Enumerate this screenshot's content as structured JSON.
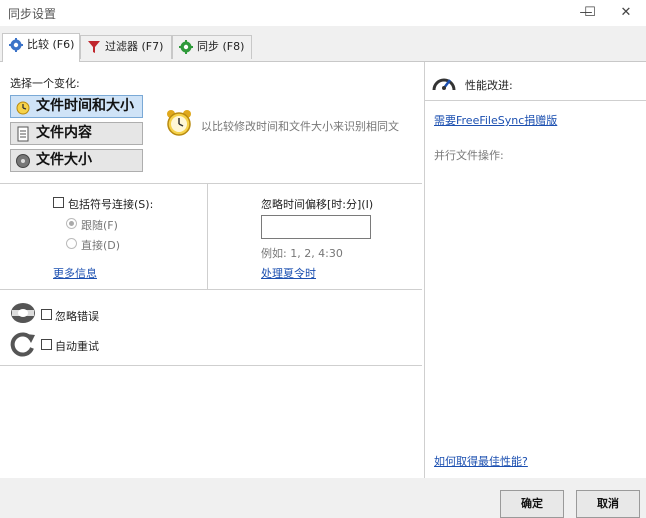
{
  "window": {
    "title": "同步设置",
    "minimize_glyph": "—",
    "maximize_glyph": "☐",
    "close_glyph": "✕"
  },
  "tabs": [
    {
      "label": "比较 (F6)",
      "icon": "gear-blue-icon",
      "active": true
    },
    {
      "label": "过滤器 (F7)",
      "icon": "filter-icon",
      "active": false
    },
    {
      "label": "同步 (F8)",
      "icon": "gear-green-icon",
      "active": false
    }
  ],
  "compare": {
    "variant_heading": "选择一个变化:",
    "variants": [
      {
        "label": "文件时间和大小",
        "icon": "clock-icon",
        "selected": true
      },
      {
        "label": "文件内容",
        "icon": "document-icon",
        "selected": false
      },
      {
        "label": "文件大小",
        "icon": "disk-icon",
        "selected": false
      }
    ],
    "variant_description": "以比较修改时间和文件大小来识别相同文",
    "symlink": {
      "checkbox_label": "包括符号连接(S):",
      "checked": false,
      "options": [
        {
          "label": "跟随(F)",
          "selected": true
        },
        {
          "label": "直接(D)",
          "selected": false
        }
      ],
      "more_info_link": "更多信息"
    },
    "time_shift": {
      "label": "忽略时间偏移[时:分](I)",
      "value": "",
      "example": "例如: 1, 2, 4:30",
      "dst_link": "处理夏令时"
    },
    "ignore_errors": {
      "label": "忽略错误",
      "checked": false
    },
    "auto_retry": {
      "label": "自动重试",
      "checked": false
    }
  },
  "performance": {
    "heading": "性能改进:",
    "donation_link": "需要FreeFileSync捐赠版",
    "parallel_label": "并行文件操作:",
    "best_performance_link": "如何取得最佳性能?"
  },
  "buttons": {
    "ok": "确定",
    "cancel": "取消"
  },
  "colors": {
    "accent": "#1b4fb0",
    "selected_variant": "#cfe3f7"
  }
}
